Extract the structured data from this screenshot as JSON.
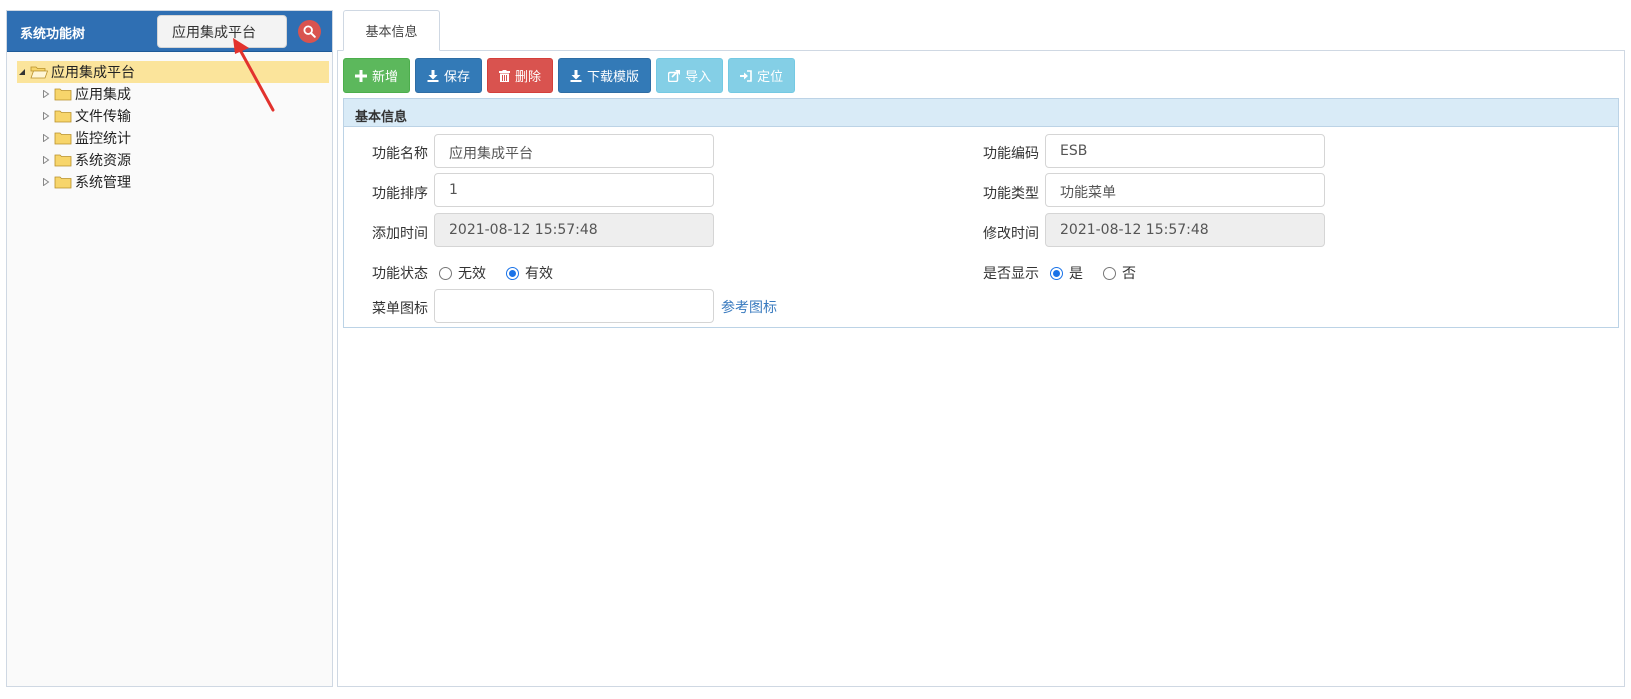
{
  "sidebar": {
    "title": "系统功能树",
    "search_value": "应用集成平台",
    "tree": {
      "root": "应用集成平台",
      "children": [
        "应用集成",
        "文件传输",
        "监控统计",
        "系统资源",
        "系统管理"
      ]
    }
  },
  "tabs": [
    "基本信息"
  ],
  "toolbar": {
    "add": "新增",
    "save": "保存",
    "delete": "删除",
    "download_template": "下载模版",
    "import": "导入",
    "locate": "定位"
  },
  "section_title": "基本信息",
  "form": {
    "name_label": "功能名称",
    "name_value": "应用集成平台",
    "code_label": "功能编码",
    "code_value": "ESB",
    "order_label": "功能排序",
    "order_value": "1",
    "type_label": "功能类型",
    "type_value": "功能菜单",
    "added_label": "添加时间",
    "added_value": "2021-08-12 15:57:48",
    "modified_label": "修改时间",
    "modified_value": "2021-08-12 15:57:48",
    "status_label": "功能状态",
    "status_options": [
      "无效",
      "有效"
    ],
    "status_selected": "有效",
    "display_label": "是否显示",
    "display_options": [
      "是",
      "否"
    ],
    "display_selected": "是",
    "icon_label": "菜单图标",
    "icon_value": "",
    "icon_ref_link": "参考图标"
  },
  "colors": {
    "header_blue": "#2f6fb3",
    "tree_selected": "#fbe49b",
    "btn_green": "#5cb85c",
    "btn_blue": "#337ab7",
    "btn_red": "#d9534f",
    "btn_info": "#5bc0de",
    "annotation_arrow": "#e2322d"
  }
}
